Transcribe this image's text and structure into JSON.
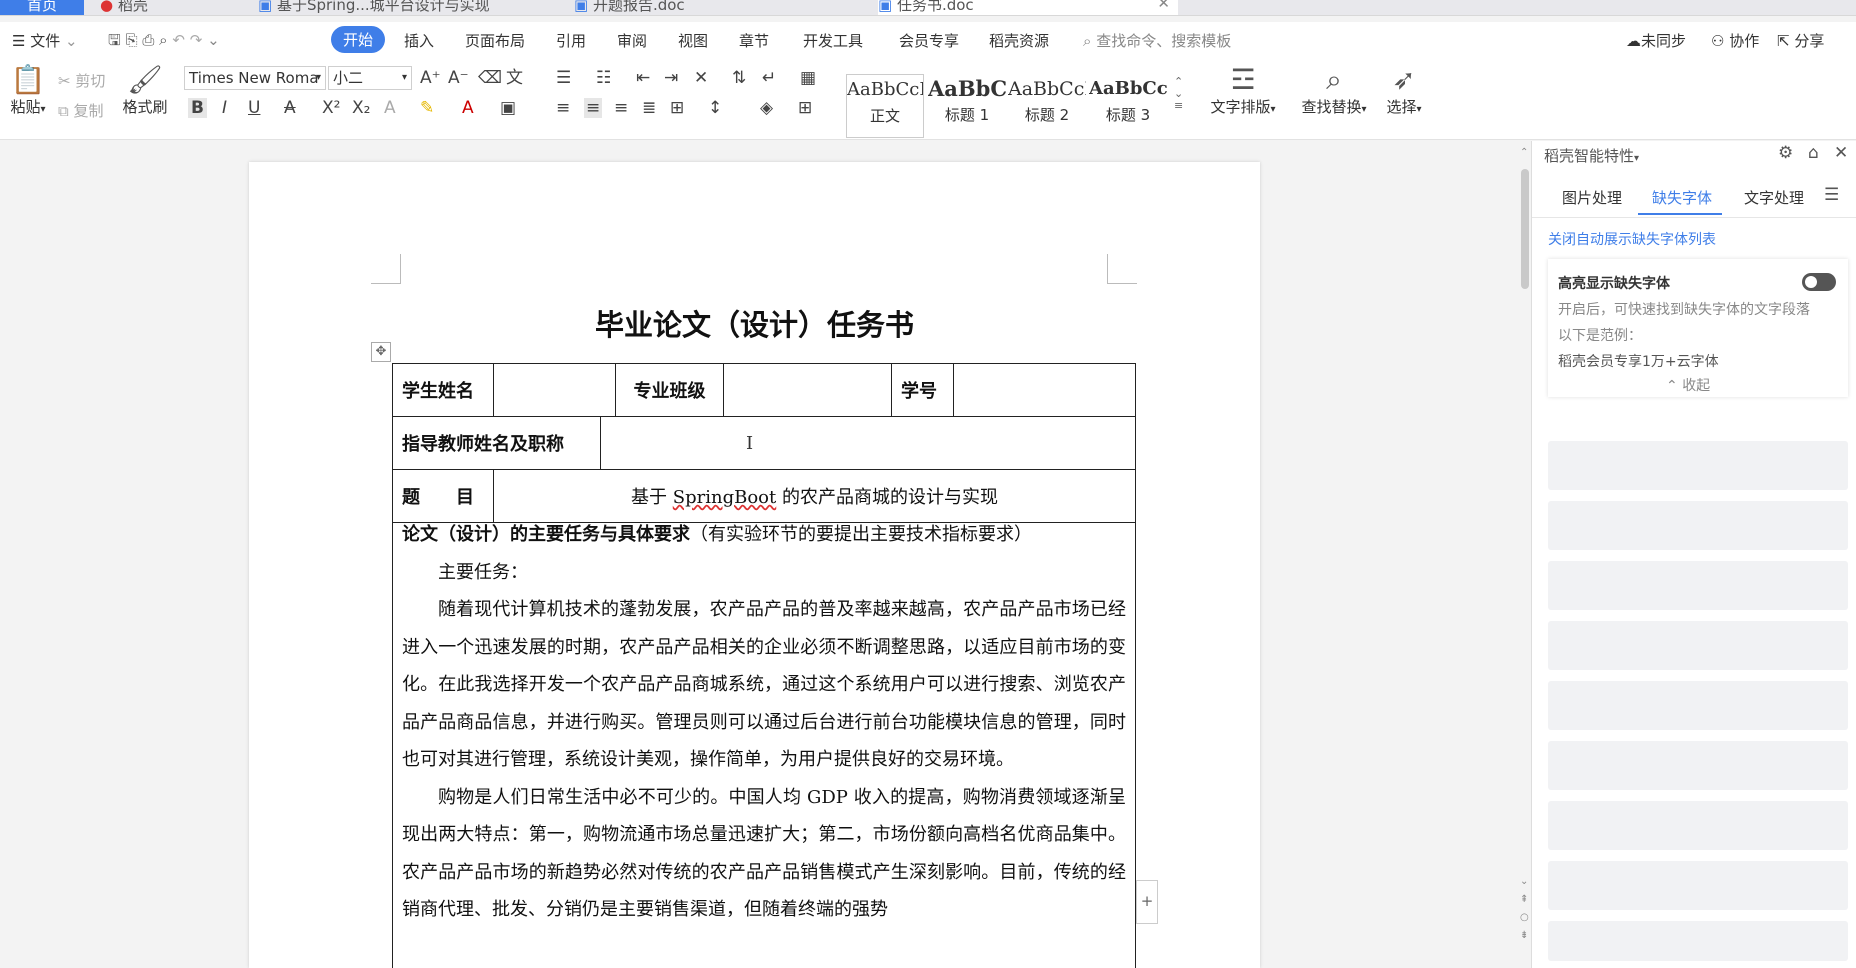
{
  "tabs": {
    "home": "首页",
    "t1": "稻壳",
    "t2": "基于Spring...城平台设计与实现",
    "t3": "开题报告.doc",
    "t4": "任务书.doc"
  },
  "menu": {
    "file": "文件",
    "items": [
      "开始",
      "插入",
      "页面布局",
      "引用",
      "审阅",
      "视图",
      "章节",
      "开发工具",
      "会员专享",
      "稻壳资源"
    ],
    "search": "查找命令、搜索模板",
    "unsync": "未同步",
    "collab": "协作",
    "share": "分享"
  },
  "ribbon": {
    "paste": "粘贴",
    "cut": "剪切",
    "copy": "复制",
    "format_painter": "格式刷",
    "font_name": "Times New Roma",
    "font_size": "小二",
    "styles": [
      {
        "sample": "AaBbCcD",
        "name": "正文"
      },
      {
        "sample": "AaBbCc",
        "name": "标题 1"
      },
      {
        "sample": "AaBbCcD",
        "name": "标题 2"
      },
      {
        "sample": "AaBbCcI",
        "name": "标题 3"
      }
    ],
    "text_layout": "文字排版",
    "find_replace": "查找替换",
    "select": "选择"
  },
  "document": {
    "title": "毕业论文（设计）任务书",
    "row1": {
      "name_label": "学生姓名",
      "name_value": "",
      "class_label": "专业班级",
      "class_value": "",
      "id_label": "学号",
      "id_value": ""
    },
    "row2": {
      "teacher_label": "指导教师姓名及职称",
      "teacher_value": ""
    },
    "row3": {
      "topic_label": "题　　目",
      "topic_pre": "基于 ",
      "topic_ul": "SpringBoot",
      "topic_post": " 的农产品商城的设计与实现"
    },
    "req_heading_bold": "论文（设计）的主要任务与具体要求",
    "req_heading_normal": "（有实验环节的要提出主要技术指标要求）",
    "main_task": "主要任务：",
    "p1": "随着现代计算机技术的蓬勃发展，农产品产品的普及率越来越高，农产品产品市场已经进入一个迅速发展的时期，农产品产品相关的企业必须不断调整思路，以适应目前市场的变化。在此我选择开发一个农产品产品商城系统，通过这个系统用户可以进行搜索、浏览农产品产品商品信息，并进行购买。管理员则可以通过后台进行前台功能模块信息的管理，同时也可对其进行管理，系统设计美观，操作简单，为用户提供良好的交易环境。",
    "p2": "购物是人们日常生活中必不可少的。中国人均 GDP 收入的提高，购物消费领域逐渐呈现出两大特点：第一，购物流通市场总量迅速扩大；第二，市场份额向高档名优商品集中。农产品产品市场的新趋势必然对传统的农产品产品销售模式产生深刻影响。目前，传统的经销商代理、批发、分销仍是主要销售渠道，但随着终端的强势"
  },
  "panel": {
    "header": "稻壳智能特性",
    "tabs": [
      "图片处理",
      "缺失字体",
      "文字处理"
    ],
    "link": "关闭自动展示缺失字体列表",
    "card_title": "高亮显示缺失字体",
    "card_desc": "开启后，可快速找到缺失字体的文字段落",
    "card_ex": "以下是范例：",
    "card_sample": "稻壳会员专享1万+云字体",
    "collapse": "收起"
  },
  "colors": {
    "accent": "#3f7ee8"
  }
}
